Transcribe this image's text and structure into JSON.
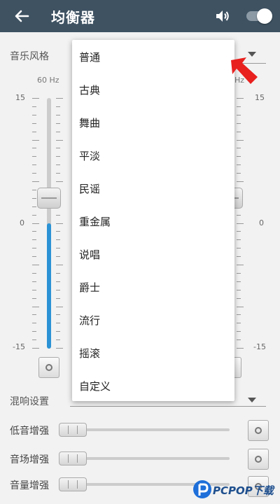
{
  "header": {
    "title": "均衡器",
    "icons": [
      "back-arrow-icon",
      "volume-icon",
      "toggle-switch"
    ],
    "background_color": "#3e5262",
    "switch_state": "on"
  },
  "music_style": {
    "label": "音乐风格"
  },
  "equalizer": {
    "bands": [
      {
        "label": "60 Hz",
        "fill": 0.5
      },
      {
        "label": "Hz"
      }
    ],
    "scale": {
      "max": "15",
      "mid": "0",
      "min": "-15"
    },
    "accent_color": "#2b93d5"
  },
  "style_menu": {
    "items": [
      "普通",
      "古典",
      "舞曲",
      "平淡",
      "民谣",
      "重金属",
      "说唱",
      "爵士",
      "流行",
      "摇滚",
      "自定义"
    ]
  },
  "reverb": {
    "label": "混响设置"
  },
  "enhancements": [
    {
      "label": "低音增强"
    },
    {
      "label": "音场增强"
    },
    {
      "label": "音量增强"
    }
  ],
  "watermark": {
    "text": "PCPOP下载"
  },
  "annotation_arrow_color": "#e8201e"
}
